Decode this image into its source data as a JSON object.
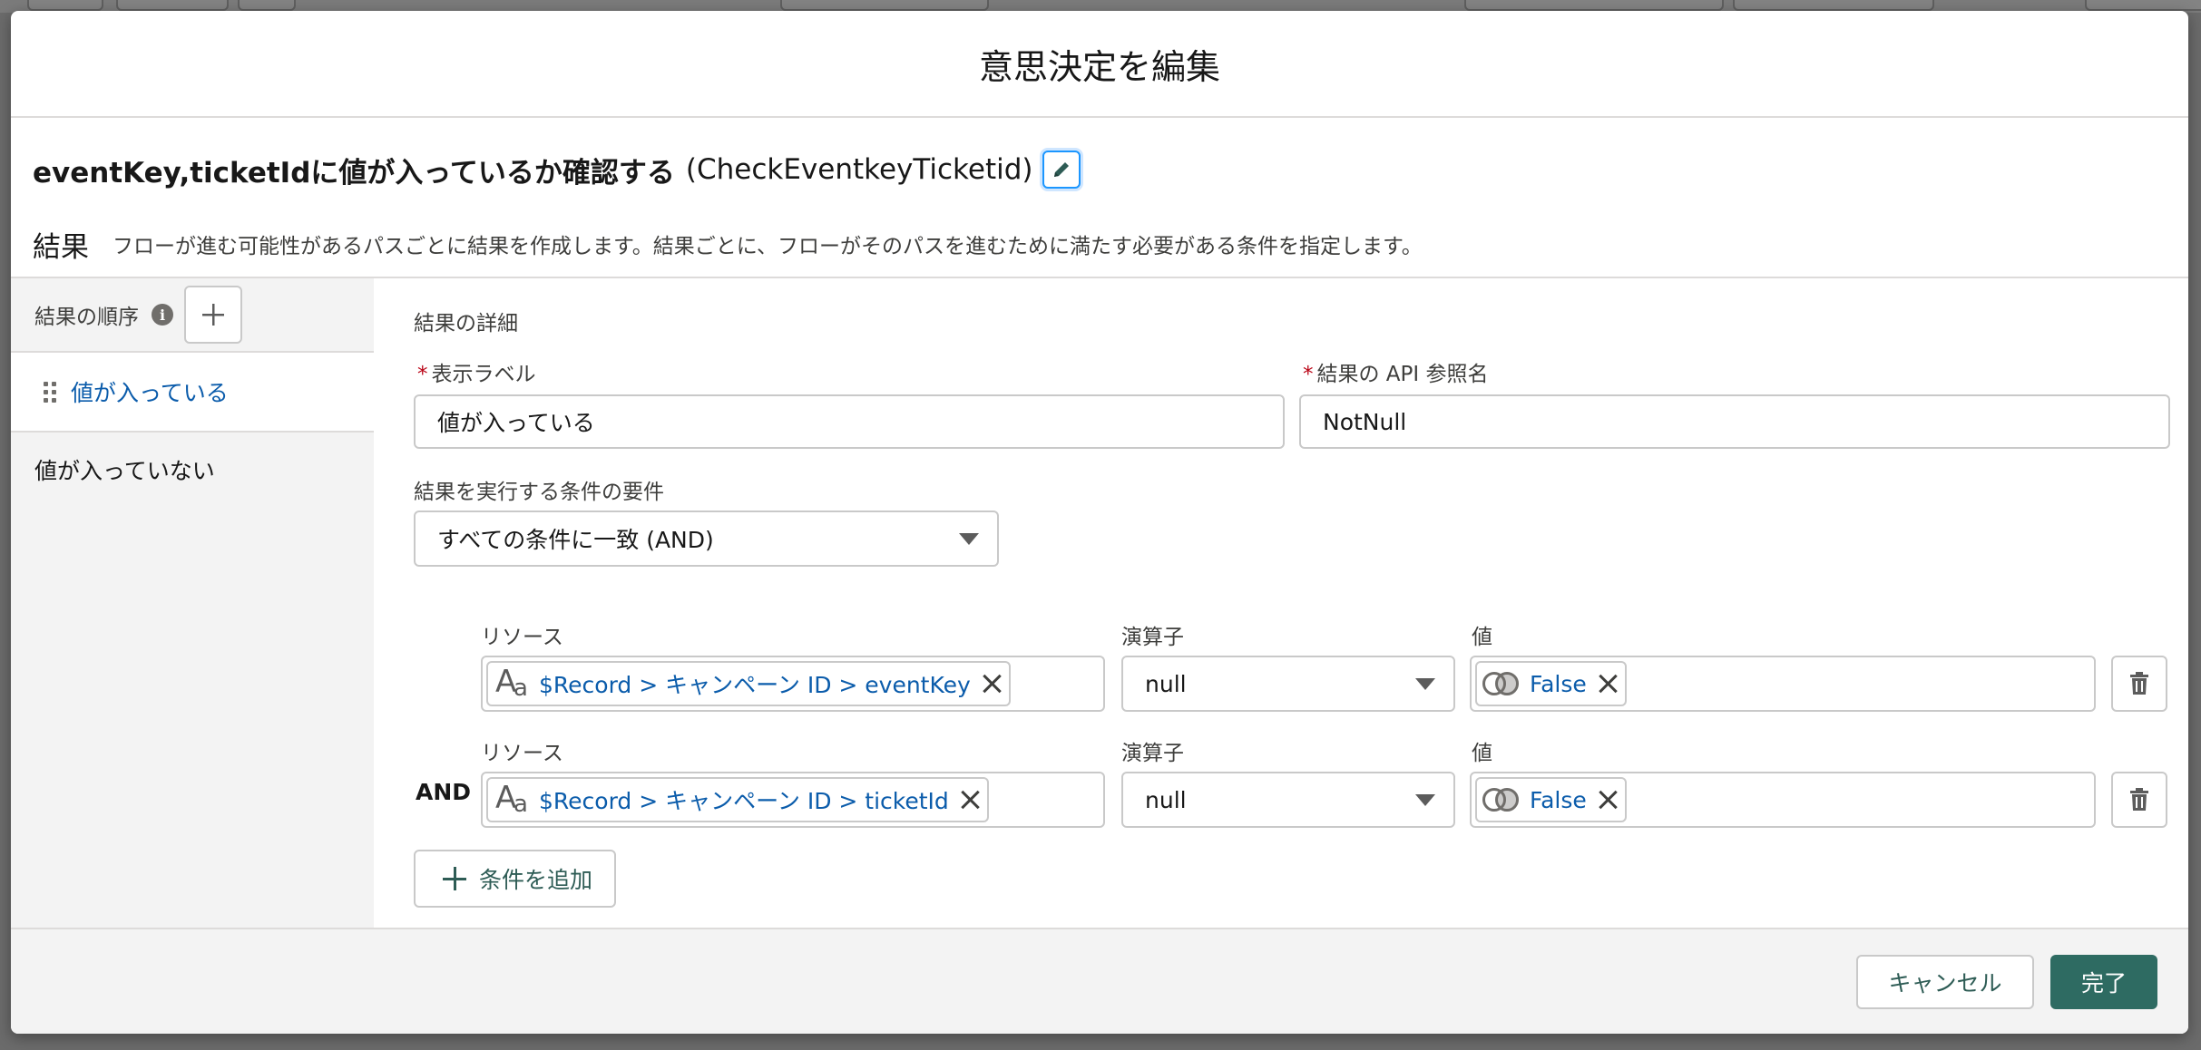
{
  "modal": {
    "title": "意思決定を編集"
  },
  "element": {
    "label": "eventKey,ticketIdに値が入っているか確認する",
    "api_name": "(CheckEventkeyTicketid)"
  },
  "outcomes": {
    "heading": "結果",
    "description": "フローが進む可能性があるパスごとに結果を作成します。結果ごとに、フローがそのパスを進むために満たす必要がある条件を指定します。"
  },
  "sidebar": {
    "order_label": "結果の順序",
    "items": [
      {
        "label": "値が入っている",
        "active": true
      },
      {
        "label": "値が入っていない",
        "active": false
      }
    ]
  },
  "details": {
    "section_title": "結果の詳細",
    "display_label_caption": "表示ラベル",
    "display_label_value": "値が入っている",
    "api_name_caption": "結果の API 参照名",
    "api_name_value": "NotNull",
    "condition_req_caption": "結果を実行する条件の要件",
    "condition_req_value": "すべての条件に一致 (AND)"
  },
  "conditions": [
    {
      "logic": "",
      "resource_caption": "リソース",
      "resource_value": "$Record > キャンペーン ID > eventKey",
      "operator_caption": "演算子",
      "operator_value": "null",
      "value_caption": "値",
      "value_value": "False"
    },
    {
      "logic": "AND",
      "resource_caption": "リソース",
      "resource_value": "$Record > キャンペーン ID > ticketId",
      "operator_caption": "演算子",
      "operator_value": "null",
      "value_caption": "値",
      "value_value": "False"
    }
  ],
  "add_condition_label": "条件を追加",
  "footer": {
    "cancel_label": "キャンセル",
    "done_label": "完了"
  },
  "colors": {
    "brand_button": "#2e6b62",
    "link_blue": "#0b5cab",
    "required_red": "#ba0517"
  },
  "icons": {
    "edit": "pencil-icon",
    "info": "info-icon",
    "add": "plus-icon",
    "drag": "drag-handle-icon",
    "text_type": "text-type-icon",
    "boolean_type": "boolean-icon",
    "remove": "close-icon",
    "delete": "trash-icon",
    "dropdown": "chevron-down-icon"
  }
}
